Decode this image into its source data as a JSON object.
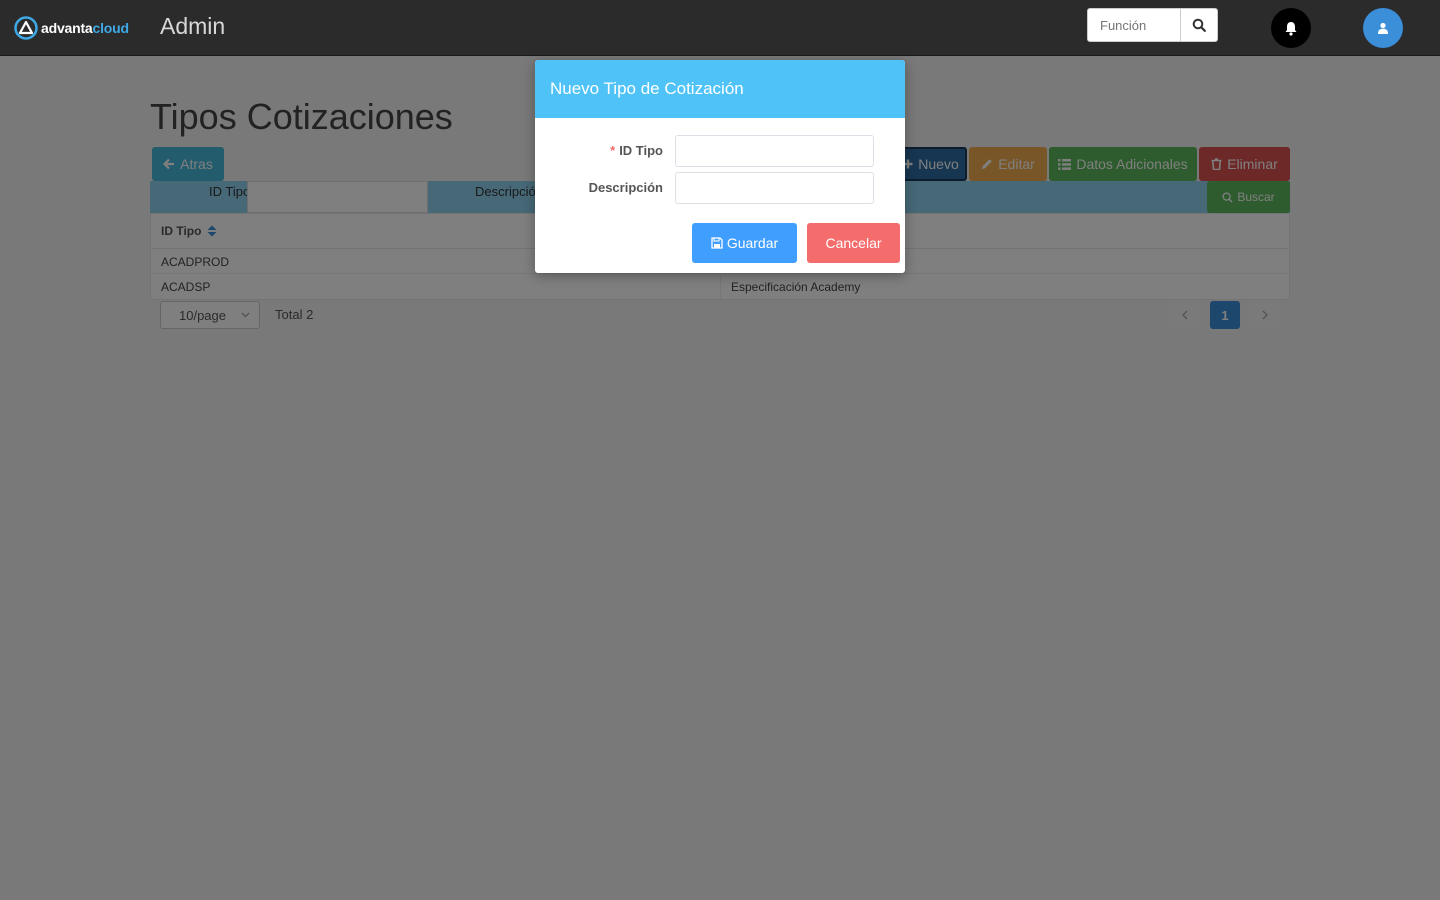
{
  "topbar": {
    "logo_part1": "advanta",
    "logo_part2": "cloud",
    "app_title": "Admin",
    "search_placeholder": "Función"
  },
  "page": {
    "title": "Tipos Cotizaciones",
    "back_label": "Atras",
    "new_label": "Nuevo",
    "edit_label": "Editar",
    "extra_label": "Datos Adicionales",
    "delete_label": "Eliminar"
  },
  "filters": {
    "id_label": "ID Tipo",
    "desc_label": "Descripción",
    "search_label": "Buscar"
  },
  "table": {
    "columns": [
      "ID Tipo"
    ],
    "rows": [
      {
        "id": "ACADPROD",
        "desc": ""
      },
      {
        "id": "ACADSP",
        "desc": "Especificación Academy"
      }
    ]
  },
  "pager": {
    "size": "10/page",
    "total": "Total 2",
    "current": "1"
  },
  "modal": {
    "title": "Nuevo Tipo de Cotización",
    "field_id_label": "ID Tipo",
    "field_id_required": "*",
    "field_desc_label": "Descripción",
    "save_label": "Guardar",
    "cancel_label": "Cancelar"
  },
  "colors": {
    "topbar": "#2b2b2b",
    "modal_header": "#4fc3f7",
    "save": "#409eff",
    "cancel": "#f56c6c"
  }
}
